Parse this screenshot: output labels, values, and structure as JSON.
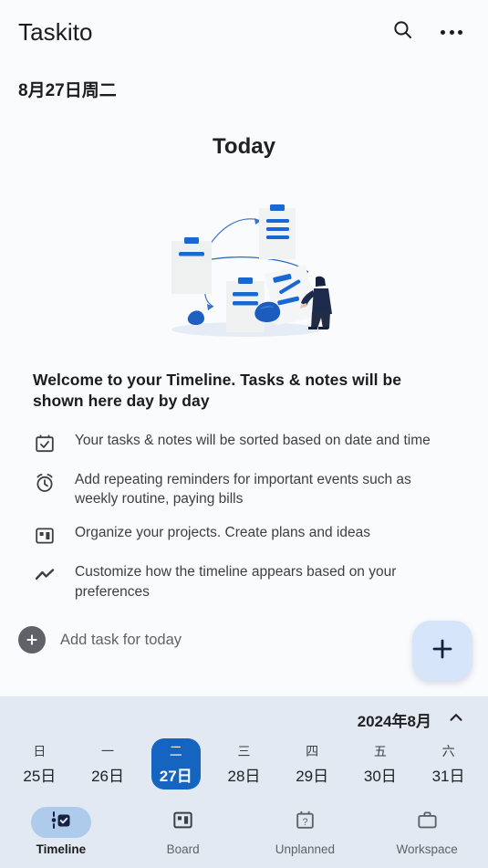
{
  "app": {
    "title": "Taskito",
    "search_icon": "search-icon",
    "overflow_icon": "more-options-icon"
  },
  "date_subtitle": "8月27日周二",
  "timeline": {
    "today_heading": "Today",
    "illustration_name": "empty-timeline-illustration",
    "welcome_title": "Welcome to your Timeline. Tasks & notes will be shown here day by day",
    "features": [
      {
        "icon": "calendar-check-icon",
        "text": "Your tasks & notes will be sorted based on date and time"
      },
      {
        "icon": "alarm-clock-icon",
        "text": "Add repeating reminders for important events such as weekly routine, paying bills"
      },
      {
        "icon": "board-icon",
        "text": "Organize your projects. Create plans and ideas"
      },
      {
        "icon": "trend-line-icon",
        "text": "Customize how the timeline appears based on your preferences"
      }
    ],
    "add_task_label": "Add task for today"
  },
  "fab": {
    "icon": "plus-icon",
    "accent": "#d7e5fa"
  },
  "calendar": {
    "month_label": "2024年8月",
    "collapse_icon": "chevron-up-icon",
    "selected_accent": "#1565c0",
    "days": [
      {
        "dow": "日",
        "dom": "25日",
        "selected": false
      },
      {
        "dow": "一",
        "dom": "26日",
        "selected": false
      },
      {
        "dow": "二",
        "dom": "27日",
        "selected": true
      },
      {
        "dow": "三",
        "dom": "28日",
        "selected": false
      },
      {
        "dow": "四",
        "dom": "29日",
        "selected": false
      },
      {
        "dow": "五",
        "dom": "30日",
        "selected": false
      },
      {
        "dow": "六",
        "dom": "31日",
        "selected": false
      }
    ]
  },
  "bottom_nav": [
    {
      "label": "Timeline",
      "icon": "timeline-check-icon",
      "active": true
    },
    {
      "label": "Board",
      "icon": "board-icon",
      "active": false
    },
    {
      "label": "Unplanned",
      "icon": "calendar-question-icon",
      "active": false
    },
    {
      "label": "Workspace",
      "icon": "briefcase-icon",
      "active": false
    }
  ]
}
